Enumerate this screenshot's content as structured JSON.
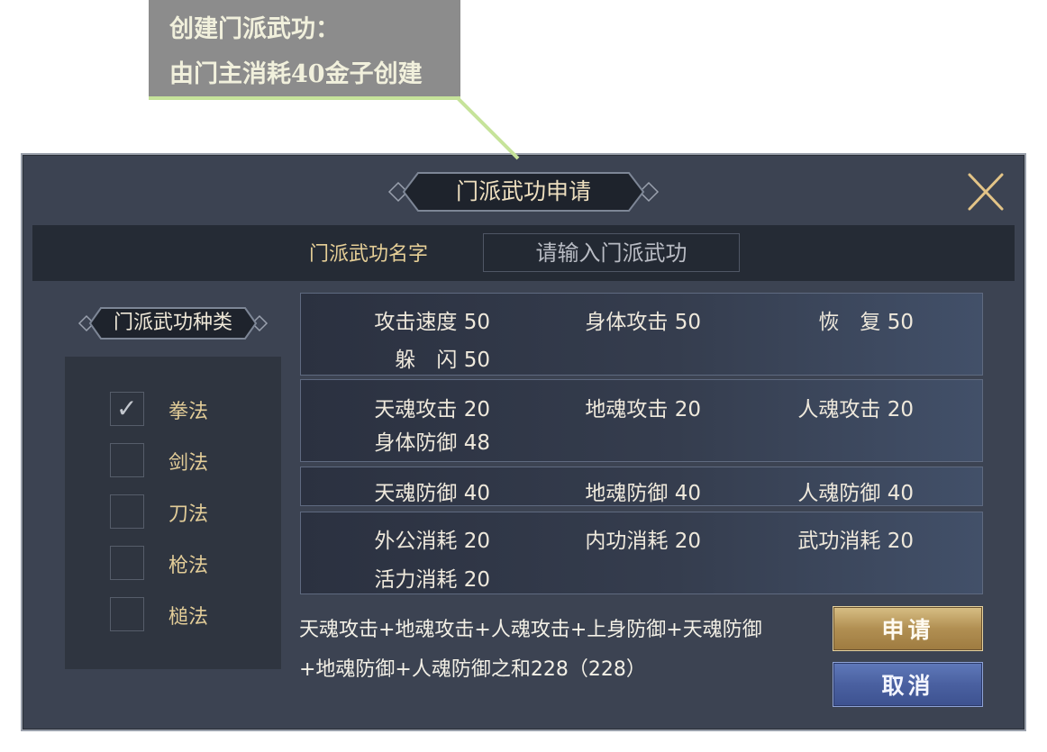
{
  "tooltip": {
    "line1": "创建门派武功：",
    "line2": "由门主消耗40金子创建"
  },
  "dialog": {
    "title": "门派武功申请",
    "close_icon": "close-x-icon"
  },
  "name_field": {
    "label": "门派武功名字",
    "placeholder": "请输入门派武功",
    "value": ""
  },
  "category": {
    "title": "门派武功种类",
    "options": [
      {
        "label": "拳法",
        "checked": true
      },
      {
        "label": "剑法",
        "checked": false
      },
      {
        "label": "刀法",
        "checked": false
      },
      {
        "label": "枪法",
        "checked": false
      },
      {
        "label": "槌法",
        "checked": false
      }
    ],
    "check_mark": "✓"
  },
  "stats": {
    "group1": [
      "攻击速度 50",
      "身体攻击 50",
      "恢　复 50",
      "躲　闪 50"
    ],
    "group2": [
      "天魂攻击 20",
      "地魂攻击 20",
      "人魂攻击 20",
      "身体防御 48"
    ],
    "group3": [
      "天魂防御 40",
      "地魂防御 40",
      "人魂防御 40"
    ],
    "group4": [
      "外公消耗 20",
      "内功消耗 20",
      "武功消耗 20",
      "活力消耗 20"
    ]
  },
  "summary": {
    "line1": "天魂攻击+地魂攻击+人魂攻击+上身防御+天魂防御",
    "line2": "+地魂防御+人魂防御之和228（228）"
  },
  "buttons": {
    "apply": "申请",
    "cancel": "取消"
  },
  "colors": {
    "panel": "#3c4352",
    "gold_text": "#e3cd98",
    "apply_button": "#b18f52",
    "cancel_button": "#4a60a0",
    "tooltip_bg": "#8c8c8c",
    "tooltip_accent": "#c6e39a"
  }
}
